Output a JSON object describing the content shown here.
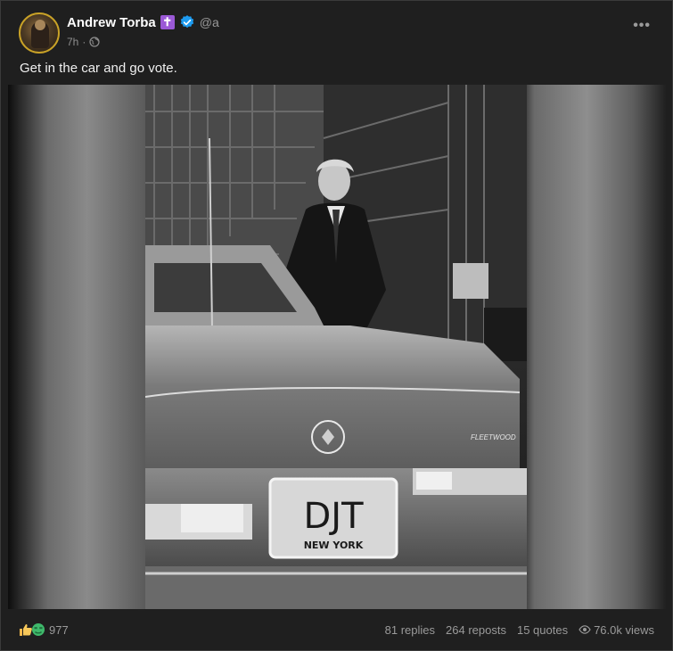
{
  "post": {
    "author": {
      "display_name": "Andrew Torba",
      "badge_glyph": "✝",
      "handle": "@a",
      "verified_color": "#1d9bf0",
      "cross_badge_color": "#9b59d6"
    },
    "meta": {
      "time": "7h",
      "separator": "·",
      "visibility_icon": "globe-icon"
    },
    "menu_icon": "more-options-icon",
    "text": "Get in the car and go vote.",
    "media": {
      "plate_text": "DJT",
      "plate_state": "NEW YORK",
      "emblem_text": "FLEETWOOD"
    }
  },
  "footer": {
    "reaction_icons": [
      "thumbs-up-icon",
      "money-face-icon"
    ],
    "reaction_count": "977",
    "replies": "81 replies",
    "reposts": "264 reposts",
    "quotes": "15 quotes",
    "views": "76.0k views"
  }
}
